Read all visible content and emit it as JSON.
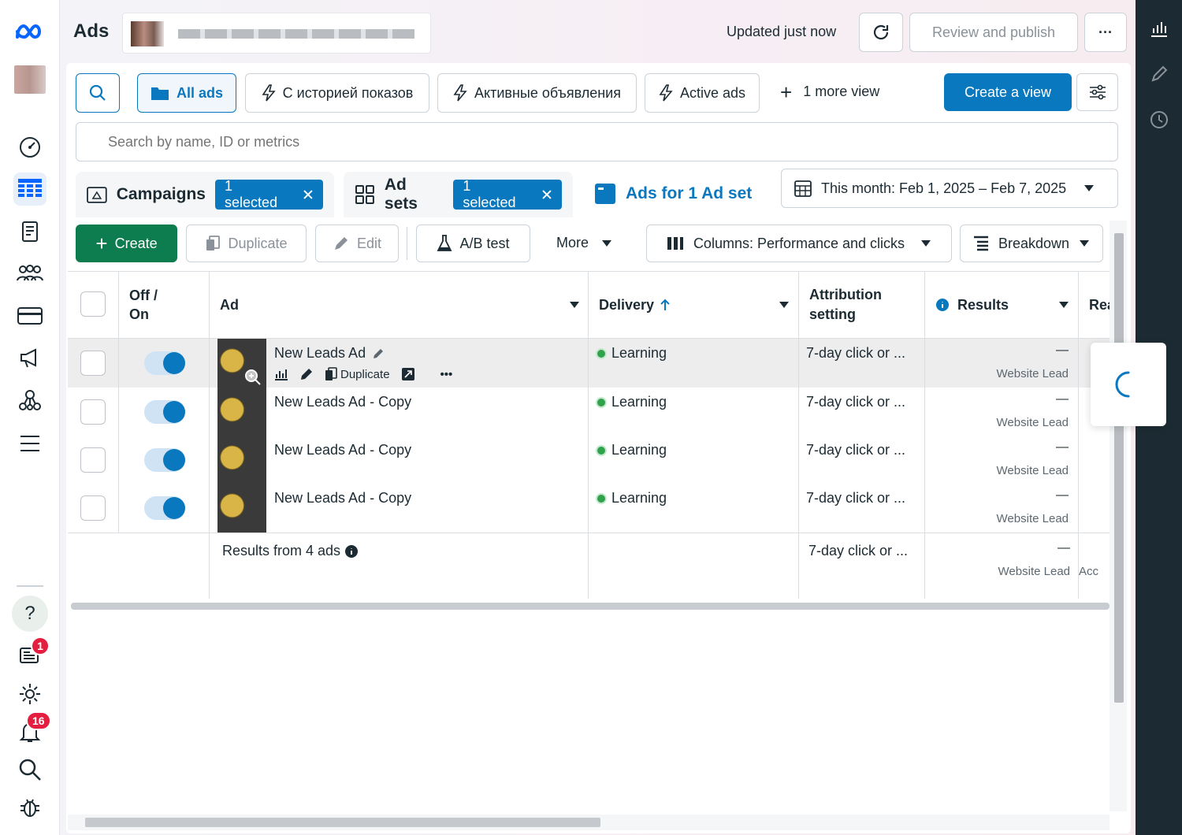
{
  "header": {
    "title": "Ads",
    "status": "Updated just now",
    "review_label": "Review and publish",
    "more_label": "···"
  },
  "views": {
    "all_ads": "All ads",
    "view_history": "С историей показов",
    "view_active_ru": "Активные объявления",
    "view_active": "Active ads",
    "more_view": "1 more view",
    "create_view": "Create a view"
  },
  "search": {
    "placeholder": "Search by name, ID or metrics"
  },
  "tabs": {
    "campaigns": "Campaigns",
    "campaigns_selected": "1 selected",
    "adsets": "Ad sets",
    "adsets_selected": "1 selected",
    "ads": "Ads for 1 Ad set"
  },
  "date_range": "This month: Feb 1, 2025 – Feb 7, 2025",
  "toolbar": {
    "create": "Create",
    "duplicate": "Duplicate",
    "edit": "Edit",
    "abtest": "A/B test",
    "more": "More",
    "columns": "Columns: Performance and clicks",
    "breakdown": "Breakdown"
  },
  "table": {
    "headers": {
      "offon": "Off / On",
      "ad": "Ad",
      "delivery": "Delivery",
      "attribution_1": "Attribution",
      "attribution_2": "setting",
      "results": "Results",
      "reach": "Rea"
    },
    "rows": [
      {
        "name": "New Leads Ad",
        "delivery": "Learning",
        "attribution": "7-day click or ...",
        "results": "—",
        "result_type": "Website Lead",
        "on": true
      },
      {
        "name": "New Leads Ad - Copy",
        "delivery": "Learning",
        "attribution": "7-day click or ...",
        "results": "—",
        "result_type": "Website Lead",
        "on": true
      },
      {
        "name": "New Leads Ad - Copy",
        "delivery": "Learning",
        "attribution": "7-day click or ...",
        "results": "—",
        "result_type": "Website Lead",
        "on": true
      },
      {
        "name": "New Leads Ad - Copy",
        "delivery": "Learning",
        "attribution": "7-day click or ...",
        "results": "—",
        "result_type": "Website Lead",
        "on": true
      }
    ],
    "row_actions": {
      "duplicate": "Duplicate"
    },
    "summary": {
      "label": "Results from 4 ads",
      "attribution": "7-day click or ...",
      "results": "—",
      "result_type": "Website Lead",
      "reach": "Acc"
    }
  },
  "badges": {
    "notifications_inbox": "1",
    "alerts": "16"
  },
  "colors": {
    "primary": "#0a78be",
    "create_green": "#0d7c4e",
    "badge_red": "#e41e3f",
    "learning_green": "#31a24c"
  }
}
